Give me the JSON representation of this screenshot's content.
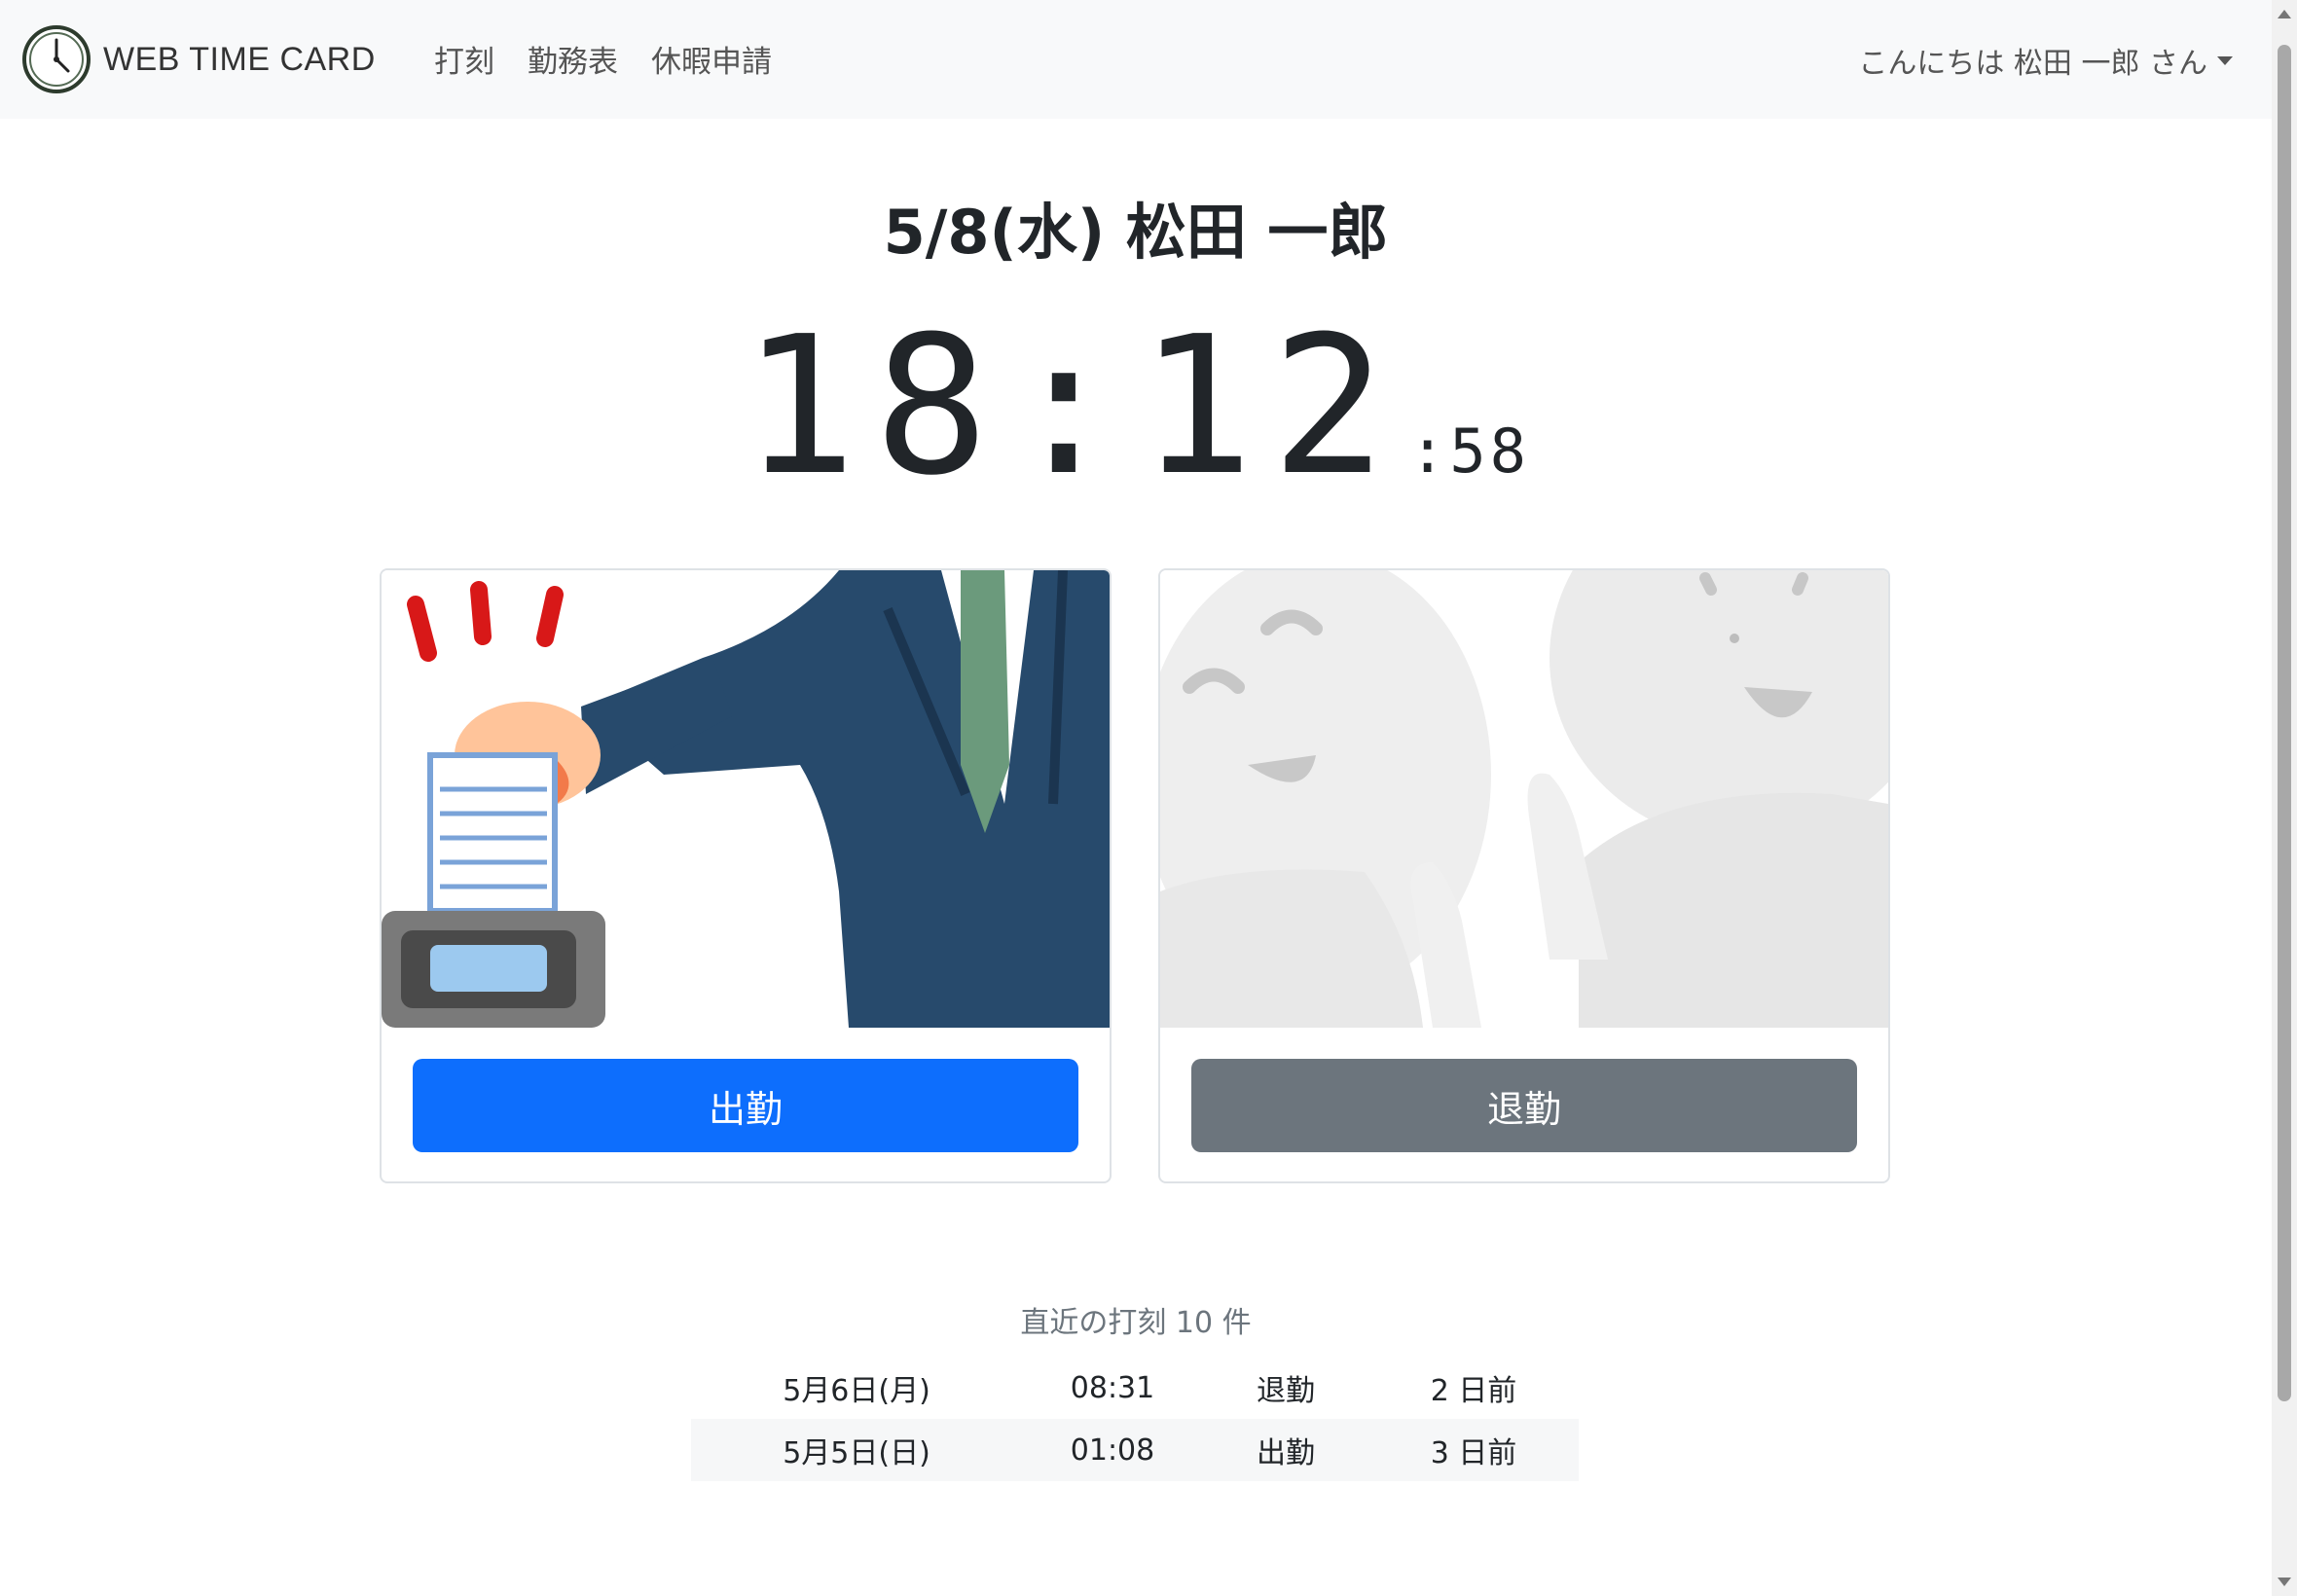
{
  "nav": {
    "brand": "WEB TIME CARD",
    "links": [
      "打刻",
      "勤務表",
      "休暇申請"
    ],
    "user_greeting": "こんにちは 松田 一郎 さん"
  },
  "main": {
    "date_title": "5/8(水) 松田 一郎",
    "time": {
      "hours": "18",
      "separator": ":",
      "minutes": "12",
      "seconds": ":58"
    },
    "clock_in_label": "出勤",
    "clock_out_label": "退勤"
  },
  "recent": {
    "title": "直近の打刻 10 件",
    "rows": [
      {
        "date": "5月6日(月)",
        "time": "08:31",
        "type": "退勤",
        "ago": "2 日前"
      },
      {
        "date": "5月5日(日)",
        "time": "01:08",
        "type": "出勤",
        "ago": "3 日前"
      }
    ]
  },
  "colors": {
    "primary": "#0d6efd",
    "secondary": "#6c757d",
    "navbar_bg": "#f8f9fa",
    "suit": "#264a6b",
    "tie": "#6a9a7a"
  }
}
